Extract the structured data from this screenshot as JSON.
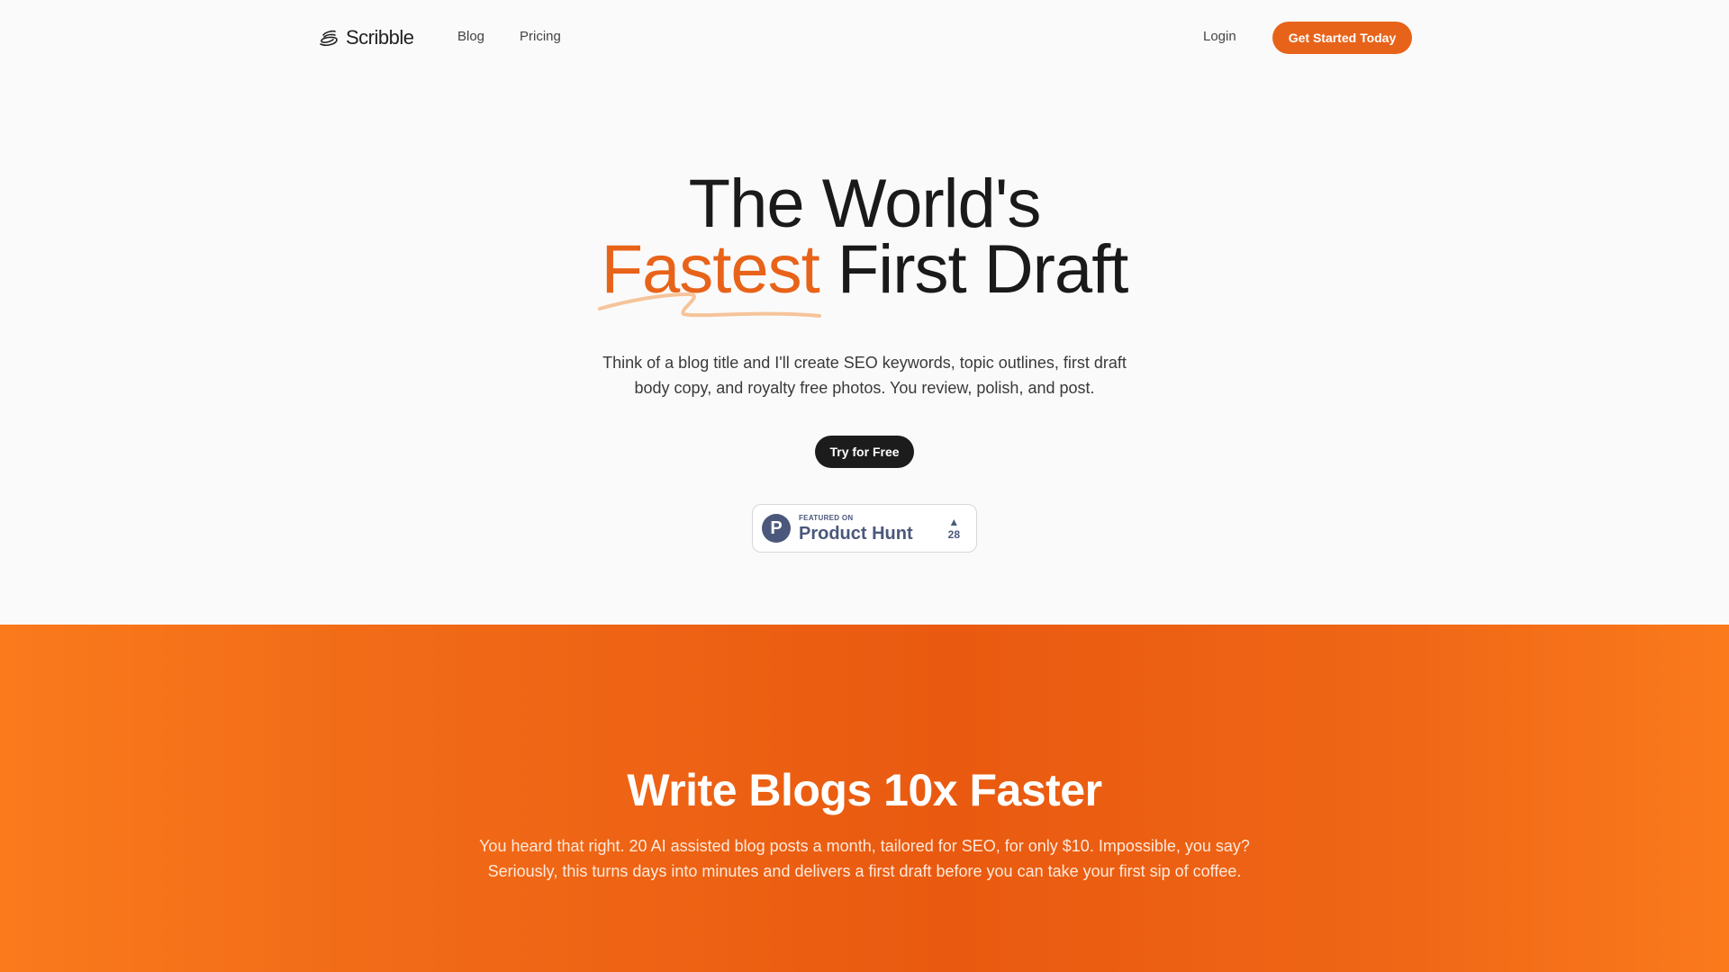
{
  "nav": {
    "logo_text": "Scribble",
    "links": [
      "Blog",
      "Pricing"
    ],
    "login": "Login",
    "cta": "Get Started Today"
  },
  "hero": {
    "title_line1": "The World's",
    "title_accent": "Fastest",
    "title_line2_rest": " First Draft",
    "subtitle": "Think of a blog title and I'll create SEO keywords, topic outlines, first draft body copy, and royalty free photos. You review, polish, and post.",
    "try_button": "Try for Free"
  },
  "product_hunt": {
    "featured_label": "FEATURED ON",
    "name": "Product Hunt",
    "logo_letter": "P",
    "arrow": "▲",
    "votes": "28"
  },
  "section2": {
    "title": "Write Blogs 10x Faster",
    "subtitle": "You heard that right. 20 AI assisted blog posts a month, tailored for SEO, for only $10. Impossible, you say? Seriously, this turns days into minutes and delivers a first draft before you can take your first sip of coffee."
  },
  "colors": {
    "accent": "#e8631a",
    "dark_button": "#1c1c1c",
    "product_hunt": "#4b587c"
  },
  "icons": {
    "logo": "scribble-logo-icon",
    "product_hunt": "product-hunt-logo-icon",
    "upvote": "triangle-up-icon"
  }
}
